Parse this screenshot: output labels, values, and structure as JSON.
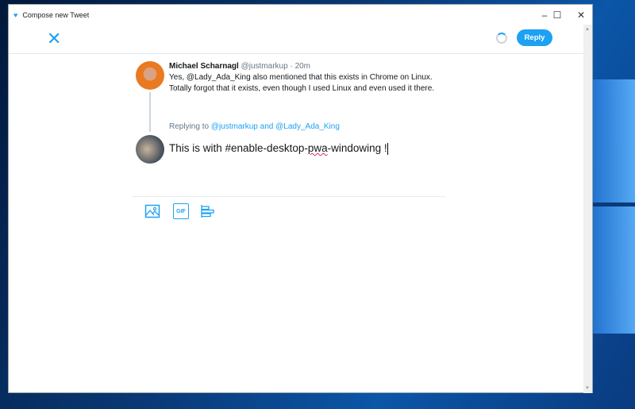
{
  "window": {
    "title": "Compose new Tweet",
    "minimize": "–",
    "maximize": "☐",
    "close": "✕"
  },
  "header": {
    "close_icon": "✕",
    "reply_label": "Reply"
  },
  "tweet": {
    "name": "Michael Scharnagl",
    "handle": "@justmarkup",
    "separator": "·",
    "time": "20m",
    "text_pre": "Yes, ",
    "mention": "@Lady_Ada_King",
    "text_post": " also mentioned that this exists in Chrome on Linux. Totally forgot that it exists, even though I used Linux and even used it there."
  },
  "replying": {
    "prefix": "Replying to ",
    "user1": "@justmarkup",
    "and": " and ",
    "user2": "@Lady_Ada_King"
  },
  "compose": {
    "pre": "This is with #enable-desktop-",
    "misspelled": "pwa",
    "post": "-windowing !"
  },
  "toolbar": {
    "gif_label": "GIF"
  },
  "colors": {
    "accent": "#1da1f2"
  }
}
